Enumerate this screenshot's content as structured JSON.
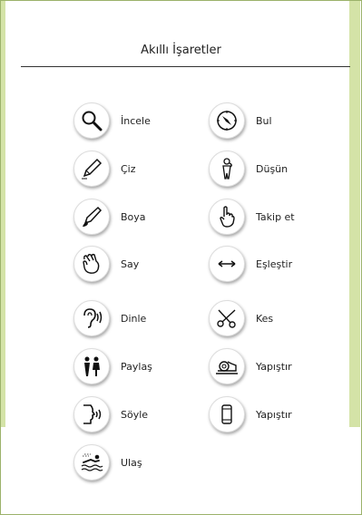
{
  "page": {
    "title": "Akıllı İşaretler"
  },
  "left_items": [
    {
      "label": "İncele",
      "icon": "magnifier-icon"
    },
    {
      "label": "Çiz",
      "icon": "pencil-icon"
    },
    {
      "label": "Boya",
      "icon": "brush-icon"
    },
    {
      "label": "Say",
      "icon": "counting-hand-icon"
    },
    {
      "label": "Dinle",
      "icon": "ear-icon"
    },
    {
      "label": "Paylaş",
      "icon": "sharing-people-icon"
    },
    {
      "label": "Söyle",
      "icon": "speaking-face-icon"
    },
    {
      "label": "Ulaş",
      "icon": "swimmer-icon"
    }
  ],
  "right_items": [
    {
      "label": "Bul",
      "icon": "compass-icon"
    },
    {
      "label": "Düşün",
      "icon": "thinking-person-icon"
    },
    {
      "label": "Takip et",
      "icon": "pointing-hand-icon"
    },
    {
      "label": "Eşleştir",
      "icon": "double-arrow-icon"
    },
    {
      "label": "Kes",
      "icon": "scissors-icon"
    },
    {
      "label": "Yapıştır",
      "icon": "tape-icon"
    },
    {
      "label": "Yapıştır",
      "icon": "glue-stick-icon"
    }
  ],
  "colors": {
    "side_panel": "#d4e3a7",
    "text": "#222222"
  }
}
